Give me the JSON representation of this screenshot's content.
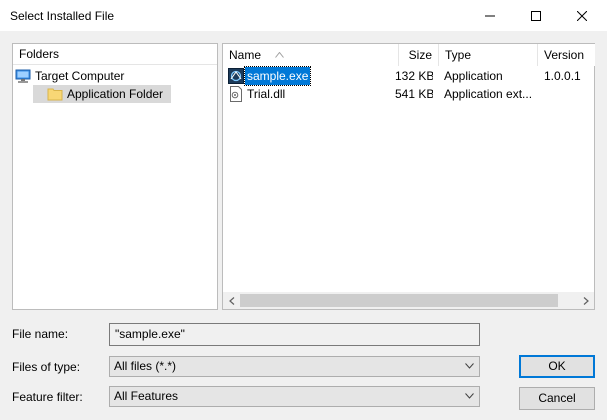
{
  "window": {
    "title": "Select Installed File"
  },
  "folders": {
    "header": "Folders",
    "items": [
      {
        "label": "Target Computer",
        "icon": "monitor-icon"
      },
      {
        "label": "Application Folder",
        "icon": "folder-icon",
        "selected": true
      }
    ]
  },
  "files": {
    "columns": {
      "name": "Name",
      "size": "Size",
      "type": "Type",
      "version": "Version"
    },
    "sort_column": "Name",
    "rows": [
      {
        "name": "sample.exe",
        "size": "132 KB",
        "type": "Application",
        "version": "1.0.0.1",
        "icon": "exe-icon",
        "selected": true
      },
      {
        "name": "Trial.dll",
        "size": "541 KB",
        "type": "Application ext...",
        "version": "",
        "icon": "dll-icon",
        "selected": false
      }
    ]
  },
  "form": {
    "file_name_label": "File name:",
    "file_name_value": "\"sample.exe\"",
    "files_of_type_label": "Files of type:",
    "files_of_type_value": "All files (*.*)",
    "feature_filter_label": "Feature filter:",
    "feature_filter_value": "All Features"
  },
  "buttons": {
    "ok": "OK",
    "cancel": "Cancel"
  },
  "colors": {
    "selection": "#0078d7",
    "folder": "#f8d775",
    "tree_selected": "#d9d9d9"
  }
}
